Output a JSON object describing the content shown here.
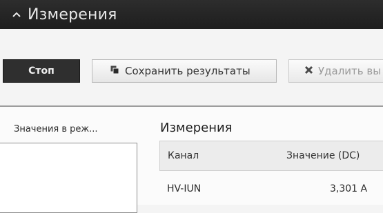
{
  "header": {
    "title": "Измерения",
    "icon": "chevron-up-icon"
  },
  "toolbar": {
    "stop_label": "Стоп",
    "save_label": "Сохранить результаты",
    "save_icon": "copy-icon",
    "delete_label": "Удалить вы",
    "delete_icon": "x-icon"
  },
  "left_panel": {
    "label": "Значения в реж..."
  },
  "measurements": {
    "title": "Измерения",
    "columns": [
      "Канал",
      "Значение (DC)"
    ],
    "rows": [
      {
        "channel": "HV-IUN",
        "value": "3,301 A"
      }
    ]
  },
  "colors": {
    "header_bg": "#1e1e1e",
    "stop_bg": "#2f2f2f",
    "disabled_text": "#9a9a9a"
  }
}
